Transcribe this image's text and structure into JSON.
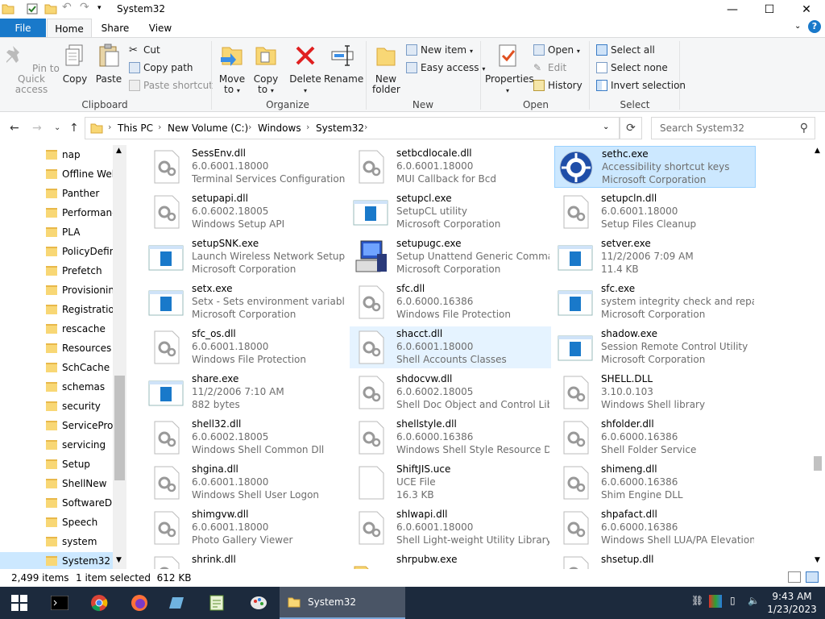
{
  "window": {
    "title": "System32",
    "controls": {
      "minimize": "—",
      "maximize": "☐",
      "close": "✕"
    }
  },
  "ribbon_tabs": [
    {
      "label": "File"
    },
    {
      "label": "Home"
    },
    {
      "label": "Share"
    },
    {
      "label": "View"
    }
  ],
  "ribbon": {
    "clipboard": {
      "pin": "Pin to Quick access",
      "copy": "Copy",
      "paste": "Paste",
      "cut": "Cut",
      "copy_path": "Copy path",
      "paste_shortcut": "Paste shortcut",
      "group_label": "Clipboard"
    },
    "organize": {
      "move_to": "Move to",
      "copy_to": "Copy to",
      "delete": "Delete",
      "rename": "Rename",
      "group_label": "Organize"
    },
    "new": {
      "new_folder": "New folder",
      "new_item": "New item",
      "easy_access": "Easy access",
      "group_label": "New"
    },
    "open": {
      "properties": "Properties",
      "open": "Open",
      "edit": "Edit",
      "history": "History",
      "group_label": "Open"
    },
    "select": {
      "select_all": "Select all",
      "select_none": "Select none",
      "invert": "Invert selection",
      "group_label": "Select"
    }
  },
  "address": {
    "crumbs": [
      "This PC",
      "New Volume (C:)",
      "Windows",
      "System32"
    ],
    "search_placeholder": "Search System32"
  },
  "nav_items": [
    {
      "label": "nap"
    },
    {
      "label": "Offline Web"
    },
    {
      "label": "Panther"
    },
    {
      "label": "Performanc"
    },
    {
      "label": "PLA"
    },
    {
      "label": "PolicyDefini"
    },
    {
      "label": "Prefetch"
    },
    {
      "label": "Provisioning"
    },
    {
      "label": "Registration"
    },
    {
      "label": "rescache"
    },
    {
      "label": "Resources"
    },
    {
      "label": "SchCache"
    },
    {
      "label": "schemas"
    },
    {
      "label": "security"
    },
    {
      "label": "ServiceProfi"
    },
    {
      "label": "servicing"
    },
    {
      "label": "Setup"
    },
    {
      "label": "ShellNew"
    },
    {
      "label": "SoftwareDis"
    },
    {
      "label": "Speech"
    },
    {
      "label": "system"
    },
    {
      "label": "System32"
    }
  ],
  "files": [
    {
      "name": "SessEnv.dll",
      "l2": "6.0.6001.18000",
      "l3": "Terminal Services Configuration s...",
      "icon": "gear-file-icon"
    },
    {
      "name": "setbcdlocale.dll",
      "l2": "6.0.6001.18000",
      "l3": "MUI Callback for Bcd",
      "icon": "gear-file-icon"
    },
    {
      "name": "sethc.exe",
      "l2": "Accessibility shortcut keys",
      "l3": "Microsoft Corporation",
      "icon": "accessibility-icon"
    },
    {
      "name": "setupapi.dll",
      "l2": "6.0.6002.18005",
      "l3": "Windows Setup API",
      "icon": "gear-file-icon"
    },
    {
      "name": "setupcl.exe",
      "l2": "SetupCL utility",
      "l3": "Microsoft Corporation",
      "icon": "app-window-icon"
    },
    {
      "name": "setupcln.dll",
      "l2": "6.0.6001.18000",
      "l3": "Setup Files Cleanup",
      "icon": "gear-file-icon"
    },
    {
      "name": "setupSNK.exe",
      "l2": "Launch Wireless Network Setup ...",
      "l3": "Microsoft Corporation",
      "icon": "app-window-icon"
    },
    {
      "name": "setupugc.exe",
      "l2": "Setup Unattend Generic Comman...",
      "l3": "Microsoft Corporation",
      "icon": "setup-computer-icon"
    },
    {
      "name": "setver.exe",
      "l2": "11/2/2006 7:09 AM",
      "l3": "11.4 KB",
      "icon": "app-window-icon"
    },
    {
      "name": "setx.exe",
      "l2": "Setx - Sets environment variables",
      "l3": "Microsoft Corporation",
      "icon": "app-window-icon"
    },
    {
      "name": "sfc.dll",
      "l2": "6.0.6000.16386",
      "l3": "Windows File Protection",
      "icon": "gear-file-icon"
    },
    {
      "name": "sfc.exe",
      "l2": "system integrity check and repair",
      "l3": "Microsoft Corporation",
      "icon": "app-window-icon"
    },
    {
      "name": "sfc_os.dll",
      "l2": "6.0.6001.18000",
      "l3": "Windows File Protection",
      "icon": "gear-file-icon"
    },
    {
      "name": "shacct.dll",
      "l2": "6.0.6001.18000",
      "l3": "Shell Accounts Classes",
      "icon": "gear-file-icon"
    },
    {
      "name": "shadow.exe",
      "l2": "Session Remote Control Utility",
      "l3": "Microsoft Corporation",
      "icon": "app-window-icon"
    },
    {
      "name": "share.exe",
      "l2": "11/2/2006 7:10 AM",
      "l3": "882 bytes",
      "icon": "app-window-icon"
    },
    {
      "name": "shdocvw.dll",
      "l2": "6.0.6002.18005",
      "l3": "Shell Doc Object and Control Libr...",
      "icon": "gear-file-icon"
    },
    {
      "name": "SHELL.DLL",
      "l2": "3.10.0.103",
      "l3": "Windows Shell library",
      "icon": "gear-file-icon"
    },
    {
      "name": "shell32.dll",
      "l2": "6.0.6002.18005",
      "l3": "Windows Shell Common Dll",
      "icon": "gear-file-icon"
    },
    {
      "name": "shellstyle.dll",
      "l2": "6.0.6000.16386",
      "l3": "Windows Shell Style Resource Dll",
      "icon": "gear-file-icon"
    },
    {
      "name": "shfolder.dll",
      "l2": "6.0.6000.16386",
      "l3": "Shell Folder Service",
      "icon": "gear-file-icon"
    },
    {
      "name": "shgina.dll",
      "l2": "6.0.6001.18000",
      "l3": "Windows Shell User Logon",
      "icon": "gear-file-icon"
    },
    {
      "name": "ShiftJIS.uce",
      "l2": "UCE File",
      "l3": "16.3 KB",
      "icon": "blank-file-icon"
    },
    {
      "name": "shimeng.dll",
      "l2": "6.0.6000.16386",
      "l3": "Shim Engine DLL",
      "icon": "gear-file-icon"
    },
    {
      "name": "shimgvw.dll",
      "l2": "6.0.6001.18000",
      "l3": "Photo Gallery Viewer",
      "icon": "gear-file-icon"
    },
    {
      "name": "shlwapi.dll",
      "l2": "6.0.6001.18000",
      "l3": "Shell Light-weight Utility Library",
      "icon": "gear-file-icon"
    },
    {
      "name": "shpafact.dll",
      "l2": "6.0.6000.16386",
      "l3": "Windows Shell LUA/PA Elevation ...",
      "icon": "gear-file-icon"
    },
    {
      "name": "shrink.dll",
      "l2": "",
      "l3": "",
      "icon": "gear-file-icon"
    },
    {
      "name": "shrpubw.exe",
      "l2": "",
      "l3": "",
      "icon": "folder-share-icon"
    },
    {
      "name": "shsetup.dll",
      "l2": "",
      "l3": "",
      "icon": "gear-file-icon"
    }
  ],
  "status": {
    "count": "2,499 items",
    "selected": "1 item selected  612 KB"
  },
  "taskbar": {
    "active_window": "System32",
    "time": "9:43 AM",
    "date": "1/23/2023"
  },
  "colors": {
    "accent": "#1979ca",
    "selection": "#cce8ff",
    "taskbar": "#1c2a3d"
  }
}
